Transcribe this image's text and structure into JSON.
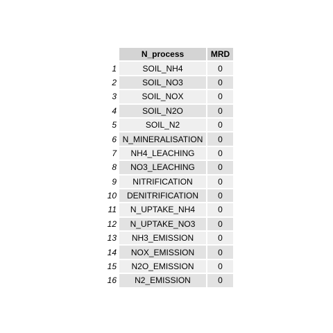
{
  "table": {
    "columns": [
      "N_process",
      "MRD"
    ],
    "rows": [
      {
        "index": "1",
        "cells": [
          "SOIL_NH4",
          "0"
        ]
      },
      {
        "index": "2",
        "cells": [
          "SOIL_NO3",
          "0"
        ]
      },
      {
        "index": "3",
        "cells": [
          "SOIL_NOX",
          "0"
        ]
      },
      {
        "index": "4",
        "cells": [
          "SOIL_N2O",
          "0"
        ]
      },
      {
        "index": "5",
        "cells": [
          "SOIL_N2",
          "0"
        ]
      },
      {
        "index": "6",
        "cells": [
          "N_MINERALISATION",
          "0"
        ]
      },
      {
        "index": "7",
        "cells": [
          "NH4_LEACHING",
          "0"
        ]
      },
      {
        "index": "8",
        "cells": [
          "NO3_LEACHING",
          "0"
        ]
      },
      {
        "index": "9",
        "cells": [
          "NITRIFICATION",
          "0"
        ]
      },
      {
        "index": "10",
        "cells": [
          "DENITRIFICATION",
          "0"
        ]
      },
      {
        "index": "11",
        "cells": [
          "N_UPTAKE_NH4",
          "0"
        ]
      },
      {
        "index": "12",
        "cells": [
          "N_UPTAKE_NO3",
          "0"
        ]
      },
      {
        "index": "13",
        "cells": [
          "NH3_EMISSION",
          "0"
        ]
      },
      {
        "index": "14",
        "cells": [
          "NOX_EMISSION",
          "0"
        ]
      },
      {
        "index": "15",
        "cells": [
          "N2O_EMISSION",
          "0"
        ]
      },
      {
        "index": "16",
        "cells": [
          "N2_EMISSION",
          "0"
        ]
      }
    ]
  },
  "colors": {
    "header_bg": "#d4d4d4",
    "row_odd_bg": "#efefef",
    "row_even_bg": "#e2e2e2"
  }
}
